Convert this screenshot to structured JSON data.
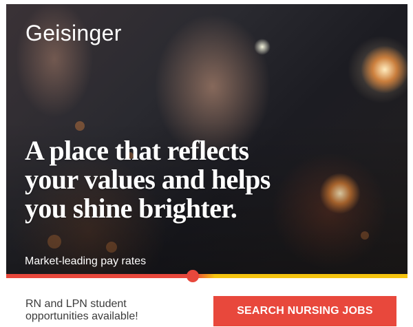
{
  "brand": {
    "name": "Geisinger"
  },
  "hero": {
    "headline_lines": [
      "A place that reflects",
      "your values and helps",
      "you shine brighter."
    ],
    "tagline": "Market-leading pay rates"
  },
  "footer": {
    "info_lines": [
      "RN and LPN student",
      "opportunities available!"
    ],
    "cta_label": "SEARCH NURSING JOBS"
  },
  "colors": {
    "accent_red": "#e8483c",
    "accent_yellow": "#f5c40f",
    "text_dark": "#3b3b3b",
    "background": "#ffffff"
  }
}
